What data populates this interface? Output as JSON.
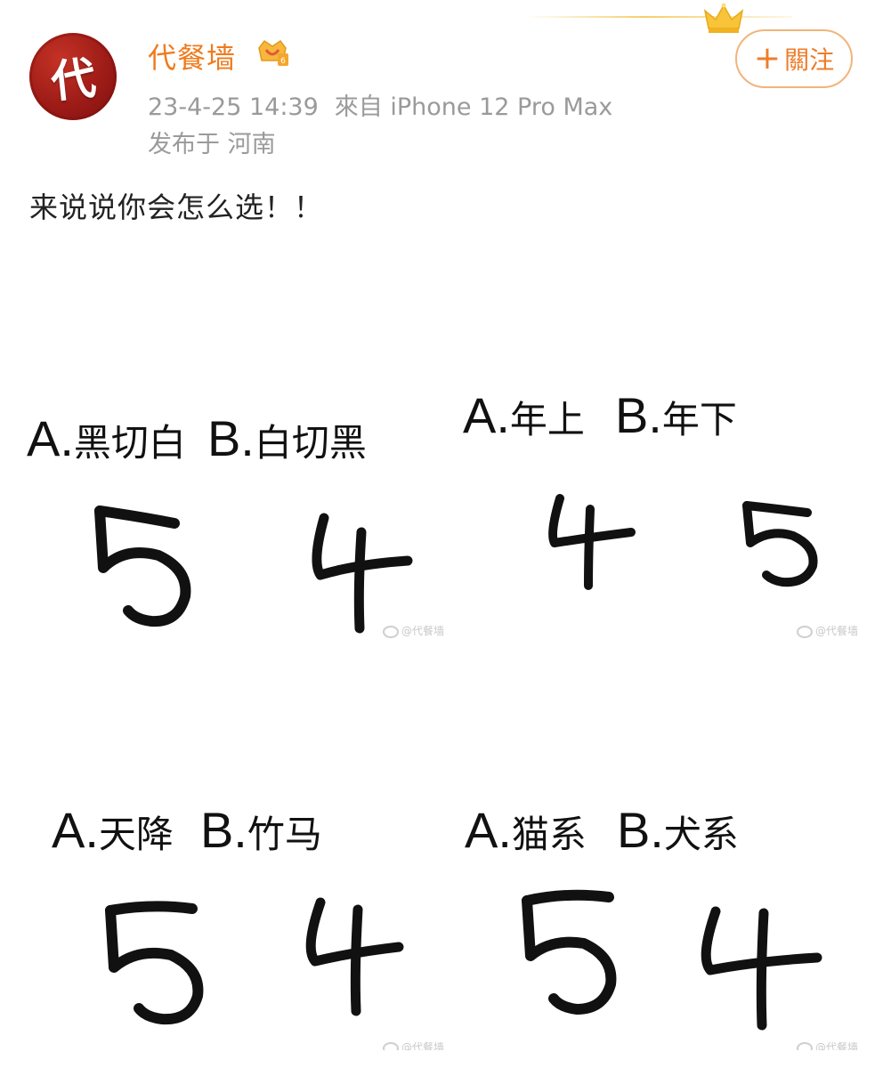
{
  "header": {
    "avatar_char": "代",
    "username": "代餐墙",
    "timestamp": "23-4-25 14:39",
    "source": "來自 iPhone 12 Pro Max",
    "location": "发布于 河南",
    "follow_plus": "+",
    "follow_label": "關注"
  },
  "post": {
    "text": "来说说你会怎么选！！"
  },
  "colors": {
    "username": "#f07a1c",
    "follow": "#ed7d2a",
    "meta": "#9a9a9a",
    "avatar_bg": "#9e1c17"
  },
  "icons": [
    "crown-icon",
    "vip-badge-icon",
    "weibo-watermark-icon"
  ],
  "cells": [
    {
      "a_letter": "A.",
      "a_text": "黑切白",
      "b_letter": "B.",
      "b_text": "白切黑",
      "a_count": "5",
      "b_count": "4",
      "watermark": "@代餐墙"
    },
    {
      "a_letter": "A.",
      "a_text": "年上",
      "b_letter": "B.",
      "b_text": "年下",
      "a_count": "4",
      "b_count": "5",
      "watermark": "@代餐墙"
    },
    {
      "a_letter": "A.",
      "a_text": "天降",
      "b_letter": "B.",
      "b_text": "竹马",
      "a_count": "5",
      "b_count": "4",
      "watermark": "@代餐墙"
    },
    {
      "a_letter": "A.",
      "a_text": "猫系",
      "b_letter": "B.",
      "b_text": "犬系",
      "a_count": "5",
      "b_count": "4",
      "watermark": "@代餐墙"
    }
  ]
}
